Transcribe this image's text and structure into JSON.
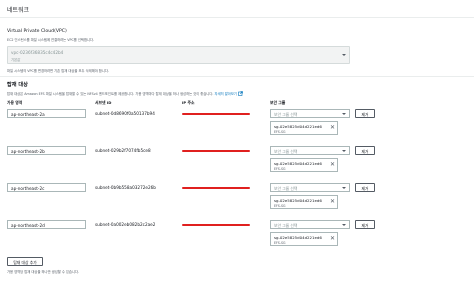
{
  "section_title": "네트워크",
  "vpc": {
    "label": "Virtual Private Cloud(VPC)",
    "description": "EC2 인스턴스를 파일 시스템에 연결하려는 VPC를 선택합니다.",
    "selected_id": "vpc-0236f36835c4c42b4",
    "selected_name": "기본값",
    "note": "파일 시스템의 VPC를 변경하려면 기존 탑재 대상을 모두 삭제해야 합니다."
  },
  "mount_targets": {
    "title": "탑재 대상",
    "description": "탑재 대상은 Amazon EFS 파일 시스템을 탑재할 수 있는 NFSv4 엔드포인트를 제공합니다. 가용 영역마다 탑재 대상을 하나 생성하는 것이 좋습니다.",
    "learn_more": "자세히 알아보기",
    "columns": {
      "az": "가용 영역",
      "subnet": "서브넷 ID",
      "ip": "IP 주소",
      "sg": "보안 그룹"
    },
    "rows": [
      {
        "az": "ap-northeast-2a",
        "subnet": "subnet-0d8690f0a50137b94",
        "sg_placeholder": "보안 그룹 선택",
        "sg_id": "sg-02e5825d04d221ed6",
        "sg_name": "EFS-SG",
        "remove": "제거"
      },
      {
        "az": "ap-northeast-2b",
        "subnet": "subnet-029b2f7074fb5ce8",
        "sg_placeholder": "보안 그룹 선택",
        "sg_id": "sg-02e5825d04d221ed6",
        "sg_name": "EFS-SG",
        "remove": "제거"
      },
      {
        "az": "ap-northeast-2c",
        "subnet": "subnet-0b9b558a03272e26b",
        "sg_placeholder": "보안 그룹 선택",
        "sg_id": "sg-02e5825d04d221ed6",
        "sg_name": "EFS-SG",
        "remove": "제거"
      },
      {
        "az": "ap-northeast-2d",
        "subnet": "subnet-0a002eb082b2c2ae2",
        "sg_placeholder": "보안 그룹 선택",
        "sg_id": "sg-02e5825d04d221ed6",
        "sg_name": "EFS-SG",
        "remove": "제거"
      }
    ],
    "add_button": "탑재 대상 추가",
    "footer_note": "가용 영역당 탑재 대상을 하나만 생성할 수 있습니다."
  },
  "colors": {
    "link": "#0073bb",
    "redaction": "#e0201f"
  },
  "icons": {
    "external_link": "external-link-icon",
    "remove_chip": "close-icon",
    "dropdown": "caret-down-icon"
  }
}
